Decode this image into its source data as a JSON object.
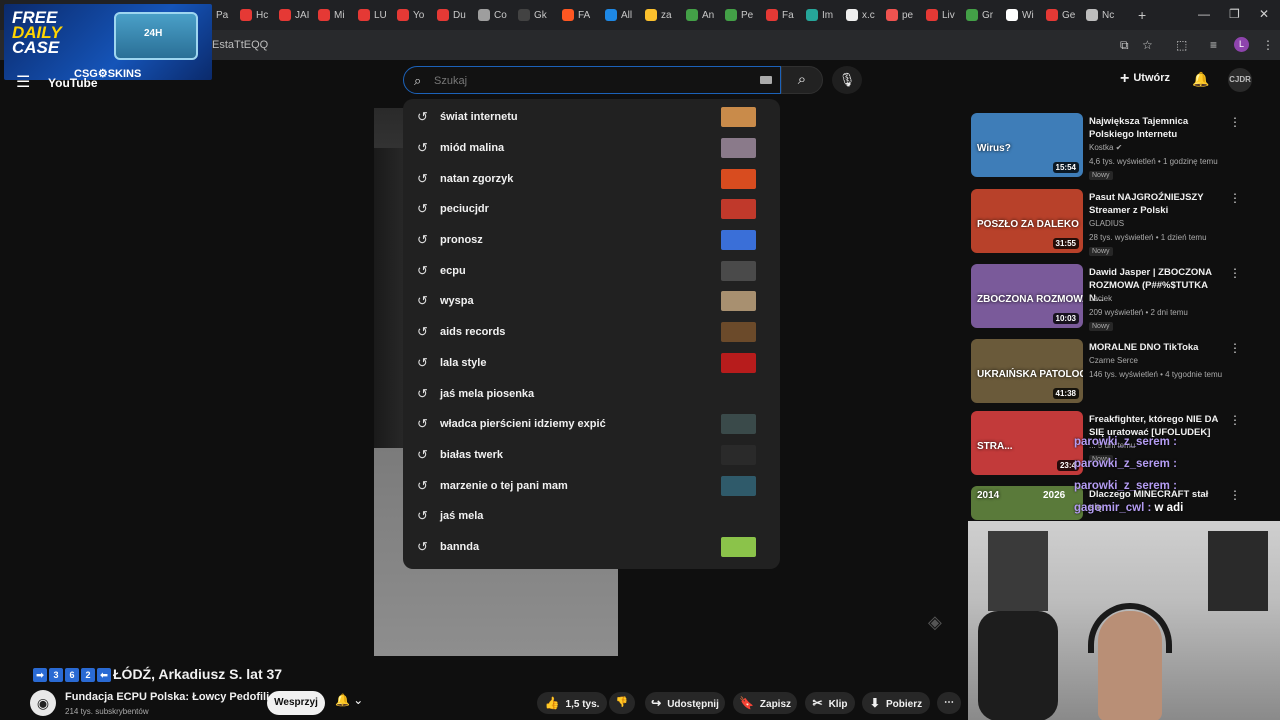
{
  "browser": {
    "tabs": [
      {
        "label": "Pa",
        "color": "#e53935"
      },
      {
        "label": "Hc",
        "color": "#e53935"
      },
      {
        "label": "JAI",
        "color": "#e53935"
      },
      {
        "label": "Mi",
        "color": "#e53935"
      },
      {
        "label": "LU",
        "color": "#e53935"
      },
      {
        "label": "Yo",
        "color": "#e53935"
      },
      {
        "label": "Du",
        "color": "#e53935"
      },
      {
        "label": "Co",
        "color": "#9e9e9e"
      },
      {
        "label": "Gk",
        "color": "#424242"
      },
      {
        "label": "FA",
        "color": "#ff5722"
      },
      {
        "label": "All",
        "color": "#1e88e5"
      },
      {
        "label": "za",
        "color": "#fbc02d"
      },
      {
        "label": "An",
        "color": "#43a047"
      },
      {
        "label": "Pe",
        "color": "#43a047"
      },
      {
        "label": "Fa",
        "color": "#e53935"
      },
      {
        "label": "Im",
        "color": "#26a69a"
      },
      {
        "label": "x.c",
        "color": "#eeeeee"
      },
      {
        "label": "pe",
        "color": "#ef5350"
      },
      {
        "label": "Liv",
        "color": "#e53935"
      },
      {
        "label": "Gr",
        "color": "#43a047"
      },
      {
        "label": "Wi",
        "color": "#ffffff"
      },
      {
        "label": "Ge",
        "color": "#e53935"
      },
      {
        "label": "Nc",
        "color": "#bdbdbd"
      }
    ],
    "new_tab": "+",
    "url_fragment": "EstaTtEQQ",
    "profile_letter": "L"
  },
  "ad": {
    "line1": "FREE",
    "line2": "DAILY",
    "line3": "CASE",
    "badge": "24H",
    "brand": "CSG⚙SKINS"
  },
  "header": {
    "logo": "YouTube",
    "search_placeholder": "Szukaj",
    "create_label": "Utwórz",
    "profile_initials": "CJDR"
  },
  "suggestions": [
    {
      "text": "świat internetu",
      "thumb": "#c98b4a"
    },
    {
      "text": "miód malina",
      "thumb": "#8a7a8a"
    },
    {
      "text": "natan zgorzyk",
      "thumb": "#d84c1f"
    },
    {
      "text": "peciucjdr",
      "thumb": "#c0392b"
    },
    {
      "text": "pronosz",
      "thumb": "#3a6fd8"
    },
    {
      "text": "ecpu",
      "thumb": "#4a4a4a"
    },
    {
      "text": "wyspa",
      "thumb": "#a89070"
    },
    {
      "text": "aids records",
      "thumb": "#6b4a2a"
    },
    {
      "text": "lala style",
      "thumb": "#b71c1c"
    },
    {
      "text": "jaś mela piosenka",
      "thumb": ""
    },
    {
      "text": "władca pierścieni idziemy expić",
      "thumb": "#3a4a4a"
    },
    {
      "text": "białas twerk",
      "thumb": "#2a2a2a"
    },
    {
      "text": "marzenie o tej pani mam",
      "thumb": "#2f5a6a"
    },
    {
      "text": "jaś mela",
      "thumb": ""
    },
    {
      "text": "bannda",
      "thumb": "#8bc34a"
    }
  ],
  "recommendations": [
    {
      "title": "Największa Tajemnica Polskiego Internetu",
      "channel": "Kostka ✔",
      "meta": "4,6 tys. wyświetleń • 1 godzinę temu",
      "new": "Nowy",
      "duration": "15:54",
      "thumb": "#3e7db8"
    },
    {
      "title": "Pasut NAJGROŹNIEJSZY Streamer z Polski",
      "channel": "GLADIUS",
      "meta": "28 tys. wyświetleń • 1 dzień temu",
      "new": "Nowy",
      "duration": "31:55",
      "thumb": "#b8412a"
    },
    {
      "title": "Dawid Jasper | ZBOCZONA ROZMOWA (P##%$TUTKA N...",
      "channel": "baciek",
      "meta": "209 wyświetleń • 2 dni temu",
      "new": "Nowy",
      "duration": "10:03",
      "thumb": "#7a5a9a"
    },
    {
      "title": "MORALNE DNO TikToka",
      "channel": "Czarne Serce",
      "meta": "146 tys. wyświetleń • 4 tygodnie temu",
      "new": "",
      "duration": "41:38",
      "thumb": "#6a5a3a"
    },
    {
      "title": "Freakfighter, którego NIE DA SIĘ uratować [UFOLUDEK]",
      "channel": "",
      "meta": "... 5 dni temu",
      "new": "Nowy",
      "duration": "23:4",
      "thumb": "#c23a3a"
    },
    {
      "title": "Dlaczego MINECRAFT stał się",
      "channel": "",
      "meta": "",
      "new": "",
      "duration": "",
      "thumb": "#5a7a3a"
    }
  ],
  "chat": [
    {
      "user": "parowki_z_serem :",
      "msg": ""
    },
    {
      "user": "parowki_z_serem :",
      "msg": ""
    },
    {
      "user": "parowki_z_serem :",
      "msg": ""
    },
    {
      "user": "gagomir_cwl :",
      "msg": "w adi"
    }
  ],
  "video": {
    "title_prefix": [
      "➡",
      "3",
      "6",
      "2",
      "⬅"
    ],
    "title": "ŁÓDŹ, Arkadiusz S. lat 37",
    "channel": "Fundacja ECPU Polska: Łowcy Pedofili",
    "subscribers": "214 tys. subskrybentów",
    "support": "Wesprzyj",
    "likes": "1,5 tys.",
    "share": "Udostępnij",
    "save": "Zapisz",
    "clip": "Klip",
    "download": "Pobierz"
  },
  "rec_thumb_labels": {
    "r1": "Wirus?",
    "r2": "POSZŁO ZA DALEKO",
    "r3": "ZBOCZONA ROZMOWA",
    "r4": "UKRAIŃSKA PATOLOGIA",
    "r5": "STRA...",
    "r6a": "2014",
    "r6b": "2026"
  }
}
